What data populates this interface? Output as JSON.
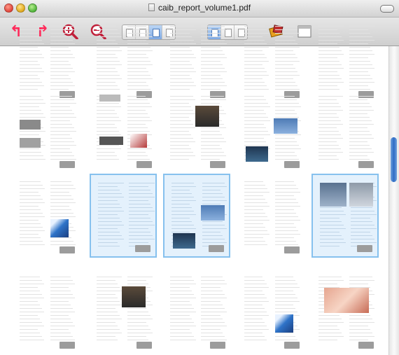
{
  "window": {
    "title": "caib_report_volume1.pdf"
  },
  "toolbar": {
    "buttons": [
      {
        "name": "previous-page-button",
        "icon": "left-arrow-icon"
      },
      {
        "name": "next-page-button",
        "icon": "right-arrow-icon"
      },
      {
        "name": "zoom-in-button",
        "icon": "zoom-in-icon"
      },
      {
        "name": "zoom-out-button",
        "icon": "zoom-out-icon"
      }
    ],
    "view_mode_selected": 2,
    "tool_mode_selected": 0
  },
  "pages": [
    {
      "row": 0,
      "col": 0,
      "selected": false
    },
    {
      "row": 0,
      "col": 1,
      "selected": false
    },
    {
      "row": 0,
      "col": 2,
      "selected": false
    },
    {
      "row": 0,
      "col": 3,
      "selected": false
    },
    {
      "row": 0,
      "col": 4,
      "selected": false
    },
    {
      "row": 1,
      "col": 0,
      "selected": false,
      "photo": "gray-pair"
    },
    {
      "row": 1,
      "col": 1,
      "selected": false,
      "photo": "diagram"
    },
    {
      "row": 1,
      "col": 2,
      "selected": false,
      "photo": "dark-photo"
    },
    {
      "row": 1,
      "col": 3,
      "selected": false,
      "photo": "blue-pair"
    },
    {
      "row": 1,
      "col": 4,
      "selected": false
    },
    {
      "row": 2,
      "col": 0,
      "selected": false,
      "photo": "shuttle-logo"
    },
    {
      "row": 2,
      "col": 1,
      "selected": true
    },
    {
      "row": 2,
      "col": 2,
      "selected": true,
      "photo": "blue-pair"
    },
    {
      "row": 2,
      "col": 3,
      "selected": false
    },
    {
      "row": 2,
      "col": 4,
      "selected": true,
      "photo": "top-photos"
    },
    {
      "row": 3,
      "col": 0,
      "selected": false
    },
    {
      "row": 3,
      "col": 1,
      "selected": false,
      "photo": "dark-photo"
    },
    {
      "row": 3,
      "col": 2,
      "selected": false
    },
    {
      "row": 3,
      "col": 3,
      "selected": false,
      "photo": "shuttle-logo"
    },
    {
      "row": 3,
      "col": 4,
      "selected": false,
      "photo": "collage"
    }
  ],
  "colors": {
    "selection_border": "#86c1ee",
    "selection_fill": "#e4f1fc",
    "arrow": "#ff2a5a",
    "scroll_thumb": "#2e6bc4"
  }
}
